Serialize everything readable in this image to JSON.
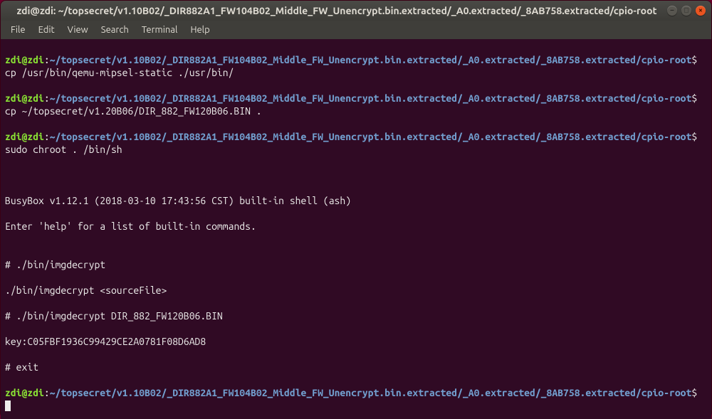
{
  "window": {
    "title": "zdi@zdi: ~/topsecret/v1.10B02/_DIR882A1_FW104B02_Middle_FW_Unencrypt.bin.extracted/_A0.extracted/_8AB758.extracted/cpio-root",
    "controls": {
      "minimize": "–",
      "maximize": "□",
      "close": "×"
    }
  },
  "menubar": {
    "file": "File",
    "edit": "Edit",
    "view": "View",
    "search": "Search",
    "terminal": "Terminal",
    "help": "Help"
  },
  "prompt": {
    "user": "zdi",
    "at": "@",
    "host": "zdi",
    "colon": ":",
    "path": "~/topsecret/v1.10B02/_DIR882A1_FW104B02_Middle_FW_Unencrypt.bin.extracted/_A0.extracted/_8AB758.extracted/cpio-root",
    "dollar": "$"
  },
  "lines": {
    "cmd1": " cp /usr/bin/qemu-mipsel-static ./usr/bin/",
    "cmd2": " cp ~/topsecret/v1.20B06/DIR_882_FW120B06.BIN .",
    "cmd3": " sudo chroot . /bin/sh",
    "blank": "",
    "busybox": "BusyBox v1.12.1 (2018-03-10 17:43:56 CST) built-in shell (ash)",
    "help": "Enter 'help' for a list of built-in commands.",
    "hash1": "# ./bin/imgdecrypt",
    "usage": "./bin/imgdecrypt <sourceFile>",
    "hash2": "# ./bin/imgdecrypt DIR_882_FW120B06.BIN",
    "key": "key:C05FBF1936C99429CE2A0781F08D6AD8",
    "hash3": "# exit"
  }
}
